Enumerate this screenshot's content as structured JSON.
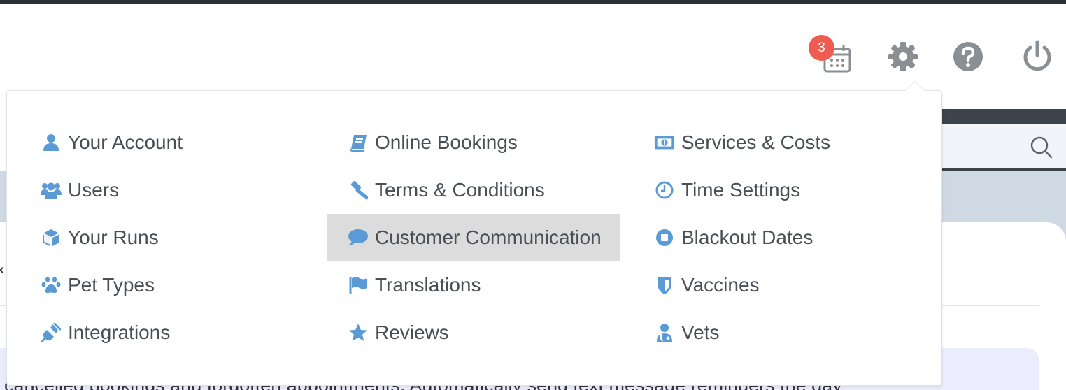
{
  "header": {
    "notification_count": "3",
    "icons": [
      "calendar-icon",
      "gear-icon",
      "help-icon",
      "power-icon"
    ]
  },
  "accent_color": "#5b9bd5",
  "badge_color": "#ee5b50",
  "settings_menu": {
    "columns": [
      [
        {
          "label": "Your Account",
          "icon": "user-icon"
        },
        {
          "label": "Users",
          "icon": "users-icon"
        },
        {
          "label": "Your Runs",
          "icon": "cube-icon"
        },
        {
          "label": "Pet Types",
          "icon": "paw-icon"
        },
        {
          "label": "Integrations",
          "icon": "plug-icon"
        }
      ],
      [
        {
          "label": "Online Bookings",
          "icon": "book-icon"
        },
        {
          "label": "Terms & Conditions",
          "icon": "gavel-icon"
        },
        {
          "label": "Customer Communication",
          "icon": "comment-icon",
          "active": true
        },
        {
          "label": "Translations",
          "icon": "flag-icon"
        },
        {
          "label": "Reviews",
          "icon": "star-icon"
        }
      ],
      [
        {
          "label": "Services & Costs",
          "icon": "money-icon"
        },
        {
          "label": "Time Settings",
          "icon": "clock-icon"
        },
        {
          "label": "Blackout Dates",
          "icon": "stop-circle-icon"
        },
        {
          "label": "Vaccines",
          "icon": "shield-icon"
        },
        {
          "label": "Vets",
          "icon": "doctor-icon"
        }
      ]
    ]
  },
  "background": {
    "info_text": "cancelled bookings and forgotten appointments. Automatically send text message reminders the day"
  }
}
